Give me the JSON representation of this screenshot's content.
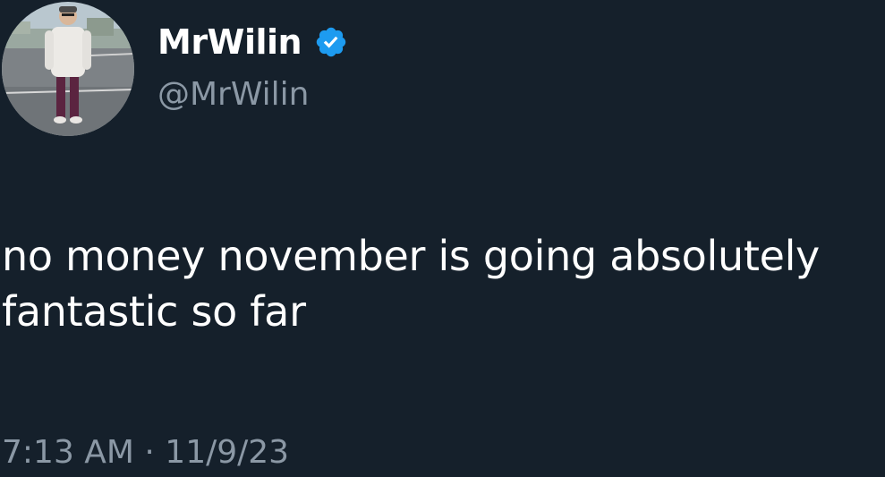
{
  "user": {
    "display_name": "MrWilin",
    "handle": "@MrWilin",
    "verified": true,
    "verified_icon": "verified-badge-icon",
    "avatar": "profile-photo"
  },
  "tweet": {
    "text": "no money november is going absolutely fantastic so far"
  },
  "meta": {
    "timestamp": "7:13 AM · 11/9/23"
  },
  "colors": {
    "background": "#15202b",
    "primary_text": "#ffffff",
    "secondary_text": "#8b98a5",
    "verified_blue": "#1d9bf0"
  }
}
